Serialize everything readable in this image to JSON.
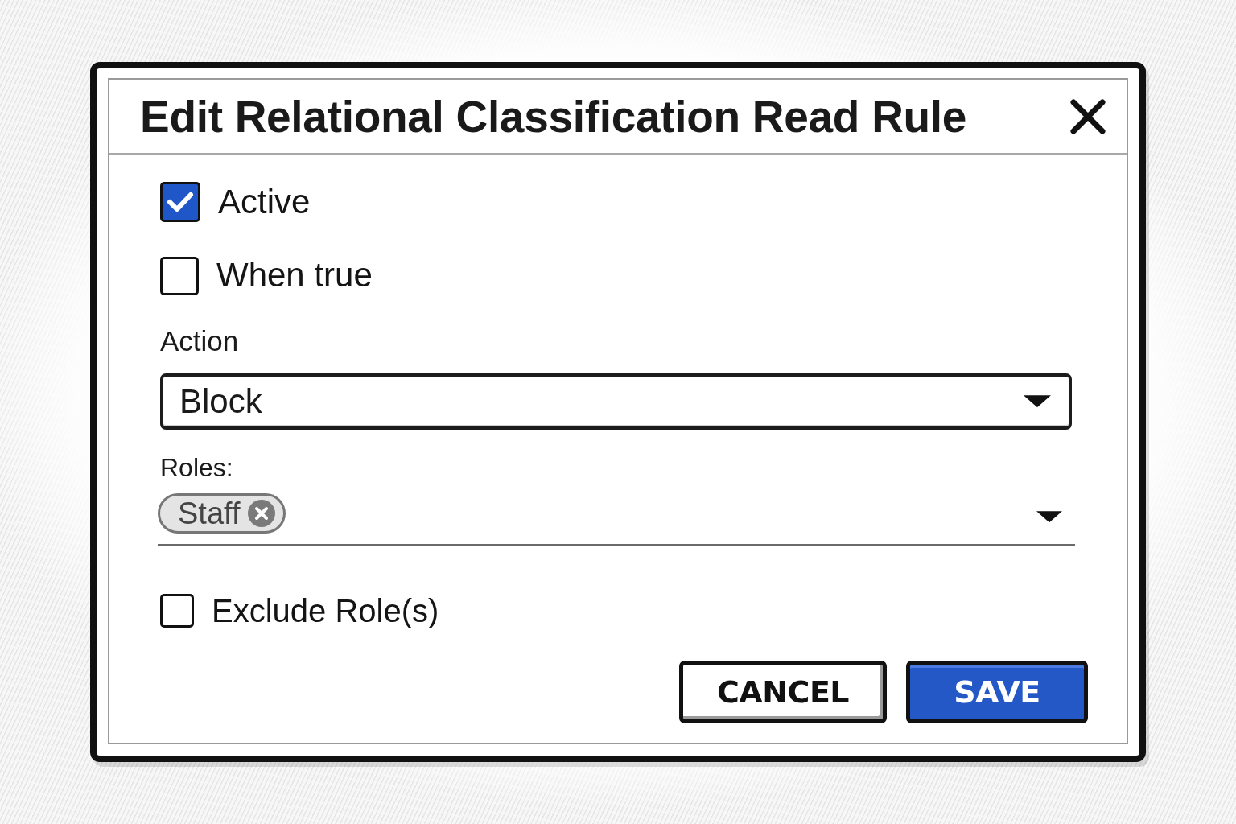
{
  "dialog": {
    "title": "Edit Relational Classification Read Rule"
  },
  "options": [
    {
      "label": "Active",
      "checked": true
    },
    {
      "label": "When true",
      "checked": false
    }
  ],
  "action": {
    "label": "Action",
    "value": "Block"
  },
  "roles": {
    "label": "Roles:",
    "tags": [
      "Staff"
    ]
  },
  "exclude_roles": {
    "label": "Exclude Role(s)",
    "checked": false
  },
  "buttons": [
    {
      "label": "CANCEL",
      "kind": "secondary"
    },
    {
      "label": "SAVE",
      "kind": "primary"
    }
  ]
}
